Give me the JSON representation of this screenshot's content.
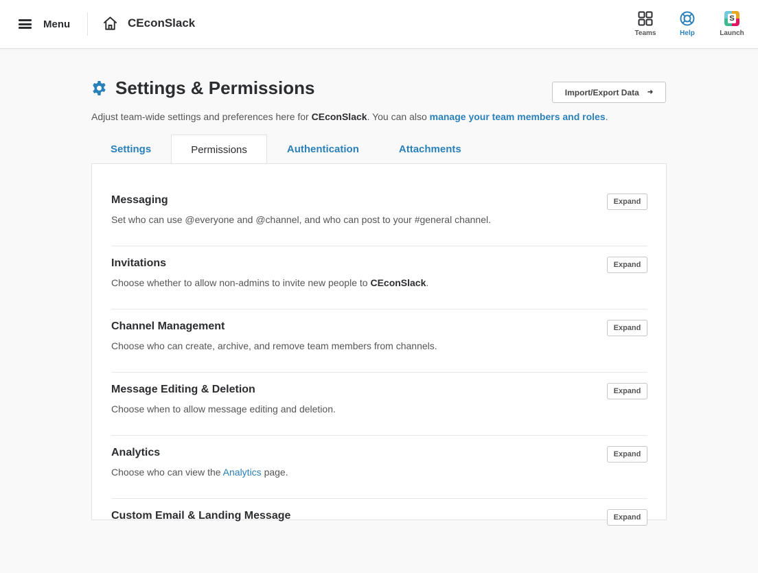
{
  "topbar": {
    "menu_label": "Menu",
    "team_name": "CEconSlack",
    "icons": [
      {
        "name": "Teams",
        "icon": "teams-grid-icon"
      },
      {
        "name": "Help",
        "icon": "help-lifebuoy-icon"
      },
      {
        "name": "Launch",
        "icon": "slack-launch-icon"
      }
    ]
  },
  "page": {
    "title": "Settings & Permissions",
    "title_icon": "gear-icon",
    "export_button": "Import/Export Data",
    "intro": {
      "before": "Adjust team-wide settings and preferences here for ",
      "team": "CEconSlack",
      "middle": ". You can also ",
      "link": "manage your team members and roles",
      "after": "."
    }
  },
  "tabs": [
    {
      "label": "Settings",
      "active": false
    },
    {
      "label": "Permissions",
      "active": true
    },
    {
      "label": "Authentication",
      "active": false
    },
    {
      "label": "Attachments",
      "active": false
    }
  ],
  "sections": [
    {
      "title": "Messaging",
      "desc": "Set who can use @everyone and @channel, and who can post to your #general channel.",
      "button": "Expand"
    },
    {
      "title": "Invitations",
      "desc_before": "Choose whether to allow non-admins to invite new people to ",
      "desc_bold": "CEconSlack",
      "desc_after": ".",
      "button": "Expand"
    },
    {
      "title": "Channel Management",
      "desc": "Choose who can create, archive, and remove team members from channels.",
      "button": "Expand"
    },
    {
      "title": "Message Editing & Deletion",
      "desc": "Choose when to allow message editing and deletion.",
      "button": "Expand"
    },
    {
      "title": "Analytics",
      "desc_before": "Choose who can view the ",
      "desc_link": "Analytics",
      "desc_after": " page.",
      "button": "Expand"
    },
    {
      "title": "Custom Email & Landing Message",
      "button": "Expand"
    }
  ],
  "colors": {
    "accent": "#2a80b9",
    "text": "#2c2d30",
    "muted": "#555555"
  }
}
